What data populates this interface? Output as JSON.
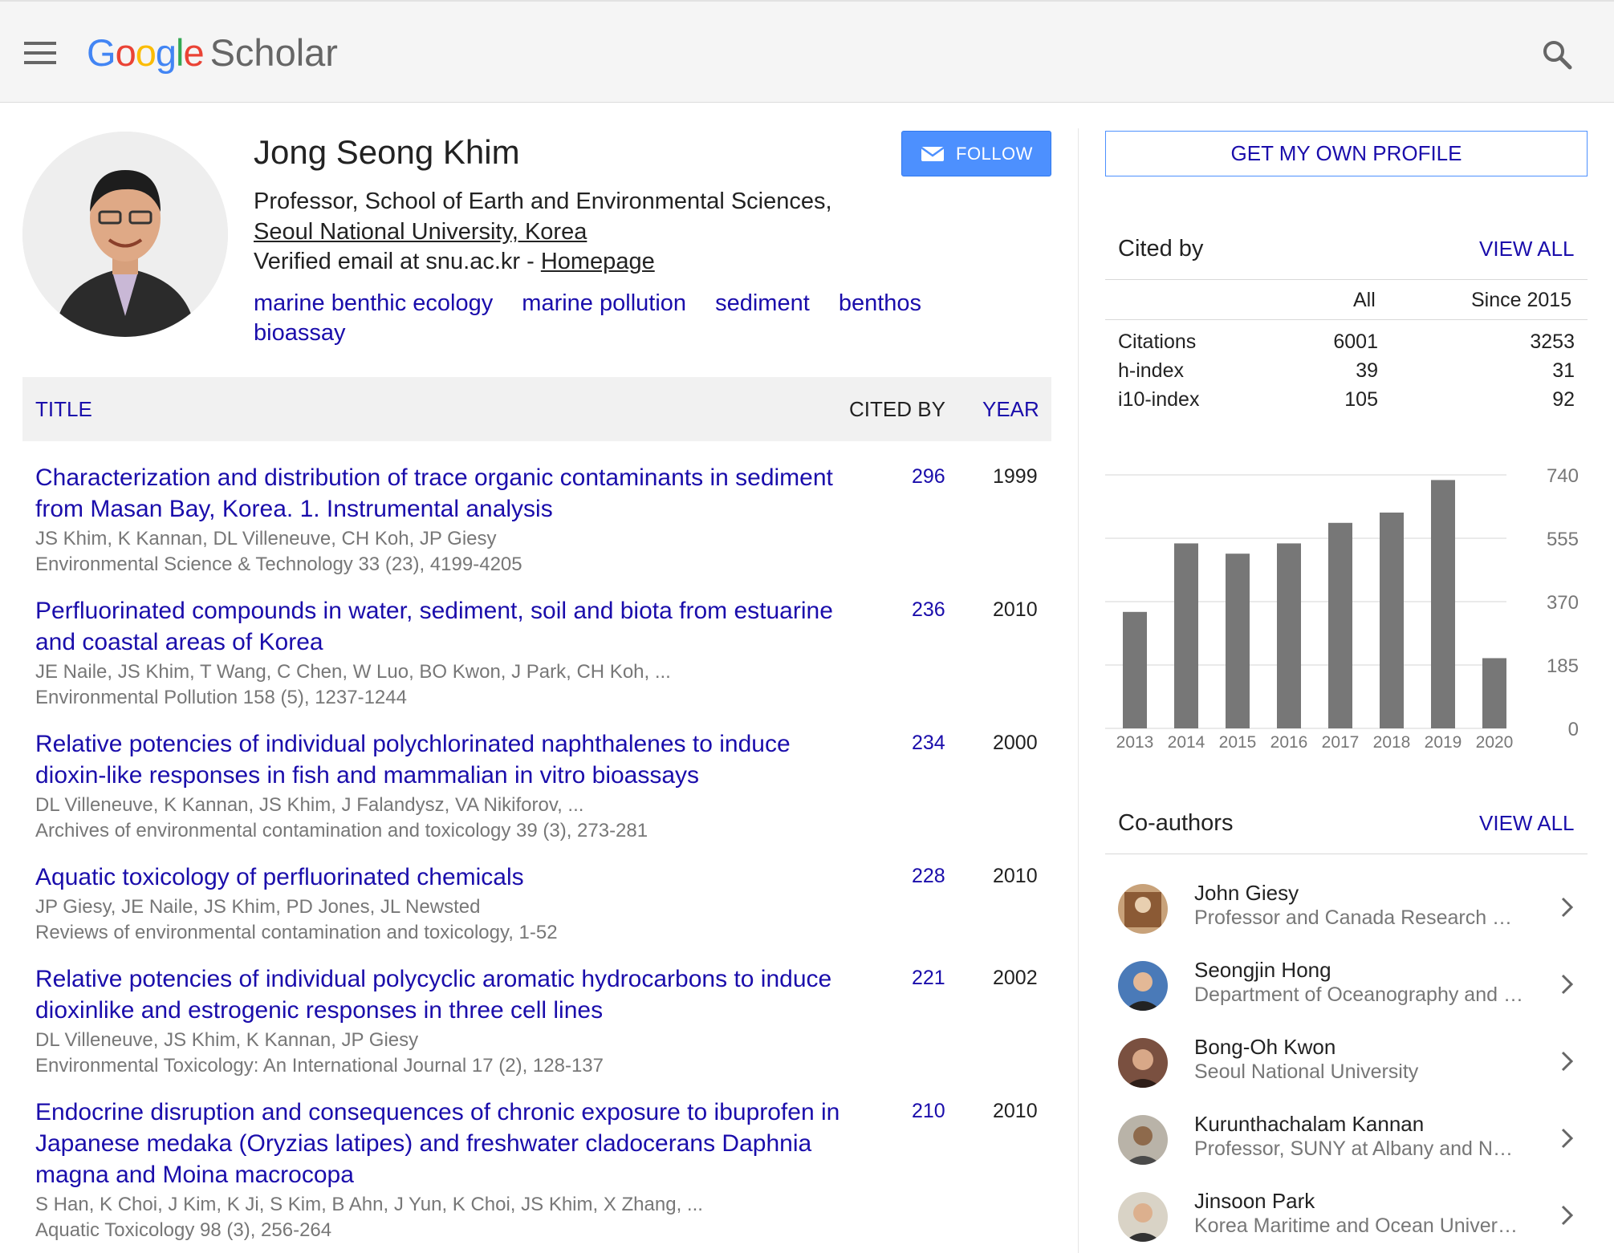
{
  "header": {
    "logo_letters": [
      "G",
      "o",
      "o",
      "g",
      "l",
      "e"
    ],
    "logo_suffix": "Scholar",
    "menu_icon": "hamburger-menu-icon",
    "search_icon": "search-icon"
  },
  "profile": {
    "name": "Jong Seong Khim",
    "affiliation_line1": "Professor, School of Earth and Environmental Sciences,",
    "affiliation_line2": "Seoul National University, Korea",
    "email_text": "Verified email at snu.ac.kr - ",
    "homepage_label": "Homepage",
    "interests": [
      "marine benthic ecology",
      "marine pollution",
      "sediment",
      "benthos",
      "bioassay"
    ],
    "follow_label": "FOLLOW"
  },
  "table": {
    "title_header": "TITLE",
    "cited_by_header": "CITED BY",
    "year_header": "YEAR",
    "rows": [
      {
        "title": "Characterization and distribution of trace organic contaminants in sediment from Masan Bay, Korea. 1. Instrumental analysis",
        "authors": "JS Khim, K Kannan, DL Villeneuve, CH Koh, JP Giesy",
        "source": "Environmental Science & Technology 33 (23), 4199-4205",
        "cited": "296",
        "year": "1999"
      },
      {
        "title": "Perfluorinated compounds in water, sediment, soil and biota from estuarine and coastal areas of Korea",
        "authors": "JE Naile, JS Khim, T Wang, C Chen, W Luo, BO Kwon, J Park, CH Koh, ...",
        "source": "Environmental Pollution 158 (5), 1237-1244",
        "cited": "236",
        "year": "2010"
      },
      {
        "title": "Relative potencies of individual polychlorinated naphthalenes to induce dioxin-like responses in fish and mammalian in vitro bioassays",
        "authors": "DL Villeneuve, K Kannan, JS Khim, J Falandysz, VA Nikiforov, ...",
        "source": "Archives of environmental contamination and toxicology 39 (3), 273-281",
        "cited": "234",
        "year": "2000"
      },
      {
        "title": "Aquatic toxicology of perfluorinated chemicals",
        "authors": "JP Giesy, JE Naile, JS Khim, PD Jones, JL Newsted",
        "source": "Reviews of environmental contamination and toxicology, 1-52",
        "cited": "228",
        "year": "2010"
      },
      {
        "title": "Relative potencies of individual polycyclic aromatic hydrocarbons to induce dioxinlike and estrogenic responses in three cell lines",
        "authors": "DL Villeneuve, JS Khim, K Kannan, JP Giesy",
        "source": "Environmental Toxicology: An International Journal 17 (2), 128-137",
        "cited": "221",
        "year": "2002"
      },
      {
        "title": "Endocrine disruption and consequences of chronic exposure to ibuprofen in Japanese medaka (Oryzias latipes) and freshwater cladocerans Daphnia magna and Moina macrocopa",
        "authors": "S Han, K Choi, J Kim, K Ji, S Kim, B Ahn, J Yun, K Choi, JS Khim, X Zhang, ...",
        "source": "Aquatic Toxicology 98 (3), 256-264",
        "cited": "210",
        "year": "2010"
      }
    ]
  },
  "sidebar": {
    "own_profile_label": "GET MY OWN PROFILE",
    "cited_by_title": "Cited by",
    "view_all_label": "VIEW ALL",
    "stats_header_all": "All",
    "stats_header_since": "Since 2015",
    "stats": [
      {
        "label": "Citations",
        "all": "6001",
        "since": "3253"
      },
      {
        "label": "h-index",
        "all": "39",
        "since": "31"
      },
      {
        "label": "i10-index",
        "all": "105",
        "since": "92"
      }
    ],
    "coauthors_title": "Co-authors",
    "coauthors": [
      {
        "name": "John Giesy",
        "affiliation": "Professor and Canada Research Chair in Environmental Toxicology"
      },
      {
        "name": "Seongjin Hong",
        "affiliation": "Department of Oceanography and Ocean Environmental Sciences"
      },
      {
        "name": "Bong-Oh Kwon",
        "affiliation": "Seoul National University"
      },
      {
        "name": "Kurunthachalam Kannan",
        "affiliation": "Professor, SUNY at Albany and New York State Department of Health"
      },
      {
        "name": "Jinsoon Park",
        "affiliation": "Korea Maritime and Ocean University"
      }
    ]
  },
  "chart_data": {
    "type": "bar",
    "categories": [
      "2013",
      "2014",
      "2015",
      "2016",
      "2017",
      "2018",
      "2019",
      "2020"
    ],
    "values": [
      340,
      540,
      510,
      540,
      600,
      630,
      725,
      205
    ],
    "ylim": [
      0,
      740
    ],
    "yticks": [
      "740",
      "555",
      "370",
      "185",
      "0"
    ],
    "ytick_values": [
      740,
      555,
      370,
      185,
      0
    ],
    "grid": true,
    "bar_color": "#777777"
  }
}
